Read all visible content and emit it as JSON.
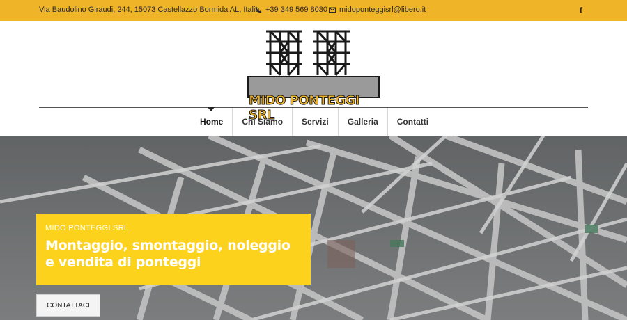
{
  "topbar": {
    "address": "Via Baudolino Giraudi, 244, 15073 Castellazzo Bormida AL, Italia",
    "phone": "+39 349 569 8030",
    "email": "midoponteggisrl@libero.it",
    "social_facebook": "f"
  },
  "logo": {
    "text": "MIDO PONTEGGI SRL"
  },
  "nav": {
    "items": [
      "Home",
      "Chi Siamo",
      "Servizi",
      "Galleria",
      "Contatti"
    ],
    "active": "Home"
  },
  "hero": {
    "brand": "MIDO PONTEGGI SRL",
    "headline": "Montaggio, smontaggio, noleggio e vendita di ponteggi",
    "cta_label": "CONTATTACI"
  },
  "colors": {
    "topbar": "#f0b429",
    "callout": "#fcd21d",
    "text_dark": "#2b2b2b"
  },
  "icons": {
    "phone": "phone-icon",
    "email": "envelope-icon",
    "facebook": "facebook-icon"
  }
}
